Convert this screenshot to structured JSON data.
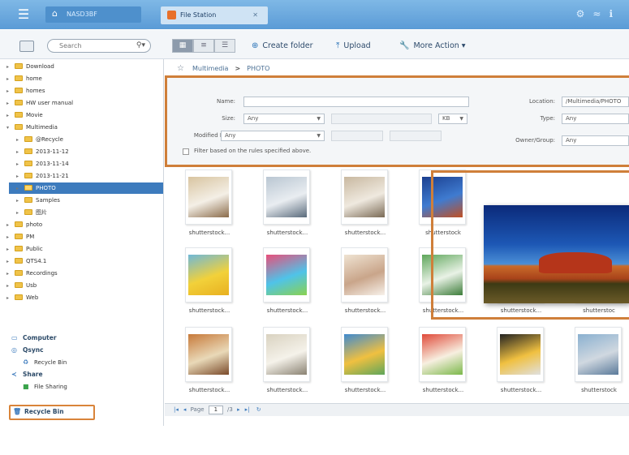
{
  "topbar": {
    "home_tab_label": "NASD3BF",
    "app_tab_label": "File Station",
    "app_tab_close": "✕"
  },
  "toolbar": {
    "search_placeholder": "Search",
    "create_folder": "Create folder",
    "upload": "Upload",
    "more_action": "More Action"
  },
  "sidebar": {
    "tree": [
      {
        "label": "Download",
        "indent": 1
      },
      {
        "label": "home",
        "indent": 1
      },
      {
        "label": "homes",
        "indent": 1
      },
      {
        "label": "HW user manual",
        "indent": 1
      },
      {
        "label": "Movie",
        "indent": 1
      },
      {
        "label": "Multimedia",
        "indent": 1
      },
      {
        "label": "@Recycle",
        "indent": 2
      },
      {
        "label": "2013-11-12",
        "indent": 2
      },
      {
        "label": "2013-11-14",
        "indent": 2
      },
      {
        "label": "2013-11-21",
        "indent": 2
      },
      {
        "label": "PHOTO",
        "indent": 2,
        "selected": true
      },
      {
        "label": "Samples",
        "indent": 2
      },
      {
        "label": "图片",
        "indent": 2
      },
      {
        "label": "photo",
        "indent": 1
      },
      {
        "label": "PM",
        "indent": 1
      },
      {
        "label": "Public",
        "indent": 1
      },
      {
        "label": "QTS4.1",
        "indent": 1
      },
      {
        "label": "Recordings",
        "indent": 1
      },
      {
        "label": "Usb",
        "indent": 1
      },
      {
        "label": "Web",
        "indent": 1
      }
    ],
    "computer": "Computer",
    "qsync": "Qsync",
    "qsync_recycle": "Recycle Bin",
    "share": "Share",
    "file_sharing": "File Sharing",
    "recycle_bin": "Recycle Bin"
  },
  "breadcrumb": {
    "root": "Multimedia",
    "separator": ">",
    "current": "PHOTO"
  },
  "filter": {
    "name_label": "Name:",
    "name_value": "",
    "size_label": "Size:",
    "size_value": "Any",
    "size_unit": "KB",
    "modified_label": "Modified Date:",
    "modified_value": "Any",
    "checkbox_label": "Filter based on the rules specified above.",
    "location_label": "Location:",
    "location_value": "/Multimedia/PHOTO",
    "type_label": "Type:",
    "type_value": "Any",
    "owner_label": "Owner/Group:",
    "owner_value": "Any"
  },
  "files": {
    "row1": [
      "shutterstock...",
      "shutterstock...",
      "shutterstock...",
      "shutterstock"
    ],
    "row2": [
      "shutterstock...",
      "shutterstock...",
      "shutterstock...",
      "shutterstock...",
      "shutterstock...",
      "shutterstoc"
    ],
    "row3": [
      "shutterstock...",
      "shutterstock...",
      "shutterstock...",
      "shutterstock...",
      "shutterstock...",
      "shutterstock"
    ]
  },
  "pager": {
    "page_label": "Page",
    "page_value": "1",
    "page_total": "/3"
  },
  "colors": {
    "highlight": "#cf7f3a",
    "topbar": "#5a9bd6",
    "selected": "#3d7bbd"
  }
}
